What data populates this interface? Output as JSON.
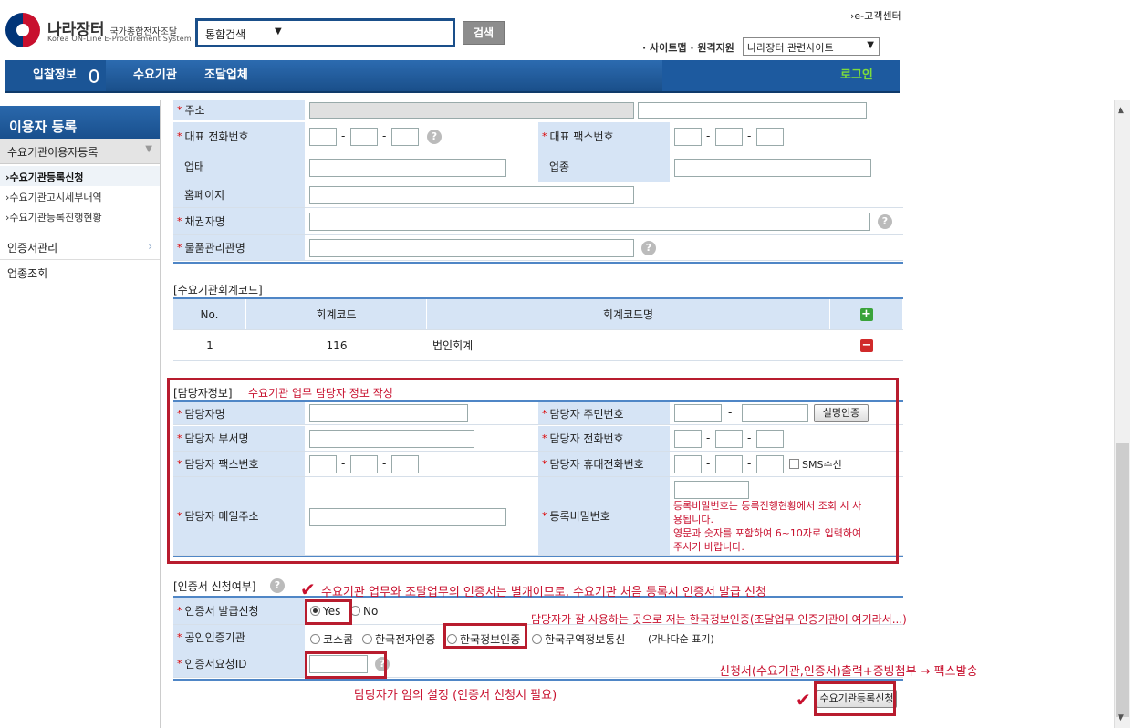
{
  "header": {
    "logo_title": "나라장터",
    "logo_title_small": "국가종합전자조달",
    "logo_sub": "Korea ON-Line E-Procurement System",
    "search_select": "통합검색",
    "search_button": "검색",
    "e_center": "›e-고객센터",
    "sitemap": "· 사이트맵 · 원격지원",
    "related_select": "나라장터 관련사이트"
  },
  "nav": {
    "bid": "입찰정보",
    "org": "수요기관",
    "supplier": "조달업체",
    "login": "로그인"
  },
  "sidebar": {
    "title": "이용자 등록",
    "sub": "수요기관이용자등록",
    "items": [
      "›수요기관등록신청",
      "›수요기관고시세부내역",
      "›수요기관등록진행현황"
    ],
    "menus": [
      "인증서관리",
      "업종조회"
    ]
  },
  "form": {
    "address": "주소",
    "rep_phone": "대표 전화번호",
    "rep_fax": "대표 팩스번호",
    "business_type": "업태",
    "business_item": "업종",
    "homepage": "홈페이지",
    "creditor": "채권자명",
    "goods_manager": "물품관리관명"
  },
  "account_code": {
    "section": "[수요기관회계코드]",
    "col_no": "No.",
    "col_code": "회계코드",
    "col_name": "회계코드명",
    "row_no": "1",
    "row_code": "116",
    "row_name": "법인회계"
  },
  "manager": {
    "section": "[담당자정보]",
    "note": "수요기관 업무 담당자 정보 작성",
    "name": "담당자명",
    "rrn": "담당자 주민번호",
    "verify_button": "실명인증",
    "dept": "담당자 부서명",
    "phone": "담당자 전화번호",
    "fax": "담당자 팩스번호",
    "mobile": "담당자 휴대전화번호",
    "sms": "SMS수신",
    "email": "담당자 메일주소",
    "reg_password": "등록비밀번호",
    "pw_note1": "등록비밀번호는 등록진행현황에서 조회 시 사",
    "pw_note2": "용됩니다.",
    "pw_note3": "영문과 숫자를 포함하여 6~10자로 입력하여",
    "pw_note4": "주시기 바랍니다."
  },
  "cert": {
    "section": "[인증서 신청여부]",
    "note1": "수요기관 업무와 조달업무의 인증서는 별개이므로, 수요기관 처음 등록시 인증서 발급 신청",
    "issue_label": "인증서 발급신청",
    "yes": "Yes",
    "no": "No",
    "note2": "담당자가 잘 사용하는 곳으로 저는 한국정보인증(조달업무 인증기관이 여기라서...)",
    "ca_label": "공인인증기관",
    "ca1": "코스콤",
    "ca2": "한국전자인증",
    "ca3": "한국정보인증",
    "ca4": "한국무역정보통신",
    "ca_note": "(가나다순 표기)",
    "req_id_label": "인증서요청ID",
    "note3": "신청서(수요기관,인증서)출력+증빙첨부 → 팩스발송",
    "note4": "담당자가 임의 설정 (인증서 신청시 필요)",
    "submit": "수요기관등록신청"
  },
  "colors": {
    "accent": "#1a4f8a",
    "annotation": "#c8102e",
    "label_bg": "#d6e4f5"
  }
}
